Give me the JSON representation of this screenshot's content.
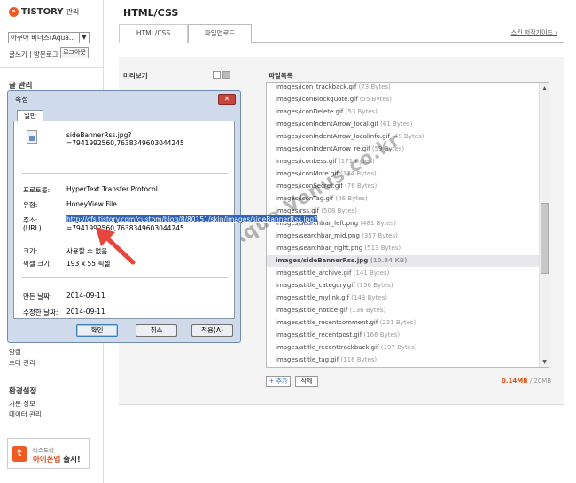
{
  "sidebar": {
    "logo_text": "TISTORY",
    "logo_sub": "관리",
    "blog_select": "아쿠아 비너스(Aqua...",
    "write_links": "글쓰기 | 방문로그",
    "logout_label": "로그아웃",
    "post_section": "글 관리",
    "items_bottom": [
      {
        "label": "알림"
      },
      {
        "label": "초대 관리"
      }
    ],
    "settings_section": "환경설정",
    "settings_items": [
      {
        "label": "기본 정보"
      },
      {
        "label": "데이터 관리"
      }
    ],
    "banner_line1": "티스토리",
    "banner_line2a": "아이폰앱",
    "banner_line2b": "출시!"
  },
  "main": {
    "page_title": "HTML/CSS",
    "tabs": [
      {
        "label": "HTML/CSS"
      },
      {
        "label": "파일업로드"
      }
    ],
    "skin_link": "스킨 저작가이드 ›",
    "preview_label": "미리보기",
    "filelist_label": "파일목록",
    "files": [
      {
        "name": "images/icon_trackback.gif",
        "size": "(73 Bytes)"
      },
      {
        "name": "images/iconBlockquote.gif",
        "size": "(55 Bytes)"
      },
      {
        "name": "images/iconDelete.gif",
        "size": "(53 Bytes)"
      },
      {
        "name": "images/iconIndentArrow_local.gif",
        "size": "(61 Bytes)"
      },
      {
        "name": "images/iconIndentArrow_localinfo.gif",
        "size": "(49 Bytes)"
      },
      {
        "name": "images/iconIndentArrow_re.gif",
        "size": "(59 Bytes)"
      },
      {
        "name": "images/iconLess.gif",
        "size": "(171 Bytes)"
      },
      {
        "name": "images/iconMore.gif",
        "size": "(174 Bytes)"
      },
      {
        "name": "images/iconSecret.gif",
        "size": "(76 Bytes)"
      },
      {
        "name": "images/iconTag.gif",
        "size": "(46 Bytes)"
      },
      {
        "name": "images/rss.gif",
        "size": "(508 Bytes)"
      },
      {
        "name": "images/searchbar_left.png",
        "size": "(481 Bytes)"
      },
      {
        "name": "images/searchbar_mid.png",
        "size": "(357 Bytes)"
      },
      {
        "name": "images/searchbar_right.png",
        "size": "(513 Bytes)"
      },
      {
        "name": "images/sideBannerRss.jpg",
        "size": "(10.84 KB)"
      },
      {
        "name": "images/stitle_archive.gif",
        "size": "(141 Bytes)"
      },
      {
        "name": "images/stitle_category.gif",
        "size": "(156 Bytes)"
      },
      {
        "name": "images/stitle_mylink.gif",
        "size": "(143 Bytes)"
      },
      {
        "name": "images/stitle_notice.gif",
        "size": "(136 Bytes)"
      },
      {
        "name": "images/stitle_recentcomment.gif",
        "size": "(221 Bytes)"
      },
      {
        "name": "images/stitle_recentpost.gif",
        "size": "(166 Bytes)"
      },
      {
        "name": "images/stitle_recenttrackback.gif",
        "size": "(197 Bytes)"
      },
      {
        "name": "images/stitle_tag.gif",
        "size": "(116 Bytes)"
      }
    ],
    "selected_file_index": 14,
    "add_label": "+ 추가",
    "delete_label": "삭제",
    "usage_used": "0.14MB",
    "usage_total": "/ 20MB"
  },
  "watermark": "www.Aqua Venus.co.kr",
  "dialog": {
    "title": "속성",
    "tab": "일반",
    "filename": "sideBannerRss.jpg?=7941992560,7638349603044245",
    "protocol_label": "프로토콜:",
    "protocol_value": "HyperText Transfer Protocol",
    "type_label": "유형:",
    "type_value": "HoneyView File",
    "address_label": "주소:",
    "address_label2": "(URL)",
    "address_selected": "http://cfs.tistory.com/custom/blog/8/80151/skin/images/sideBannerRss.jpg?",
    "address_rest": "=7941992560,7638349603044245",
    "size_label": "크기:",
    "size_value": "사용할 수 없음",
    "dims_label": "픽셀 크기:",
    "dims_value": "193 x 55 픽셀",
    "created_label": "만든 날짜:",
    "created_value": "2014-09-11",
    "modified_label": "수정한 날짜:",
    "modified_value": "2014-09-11",
    "ok_label": "확인",
    "cancel_label": "취소",
    "apply_label": "적용(A)"
  },
  "colors": {
    "brand": "#f15a24",
    "selection": "#3064b8",
    "arrow": "#e8453c"
  }
}
